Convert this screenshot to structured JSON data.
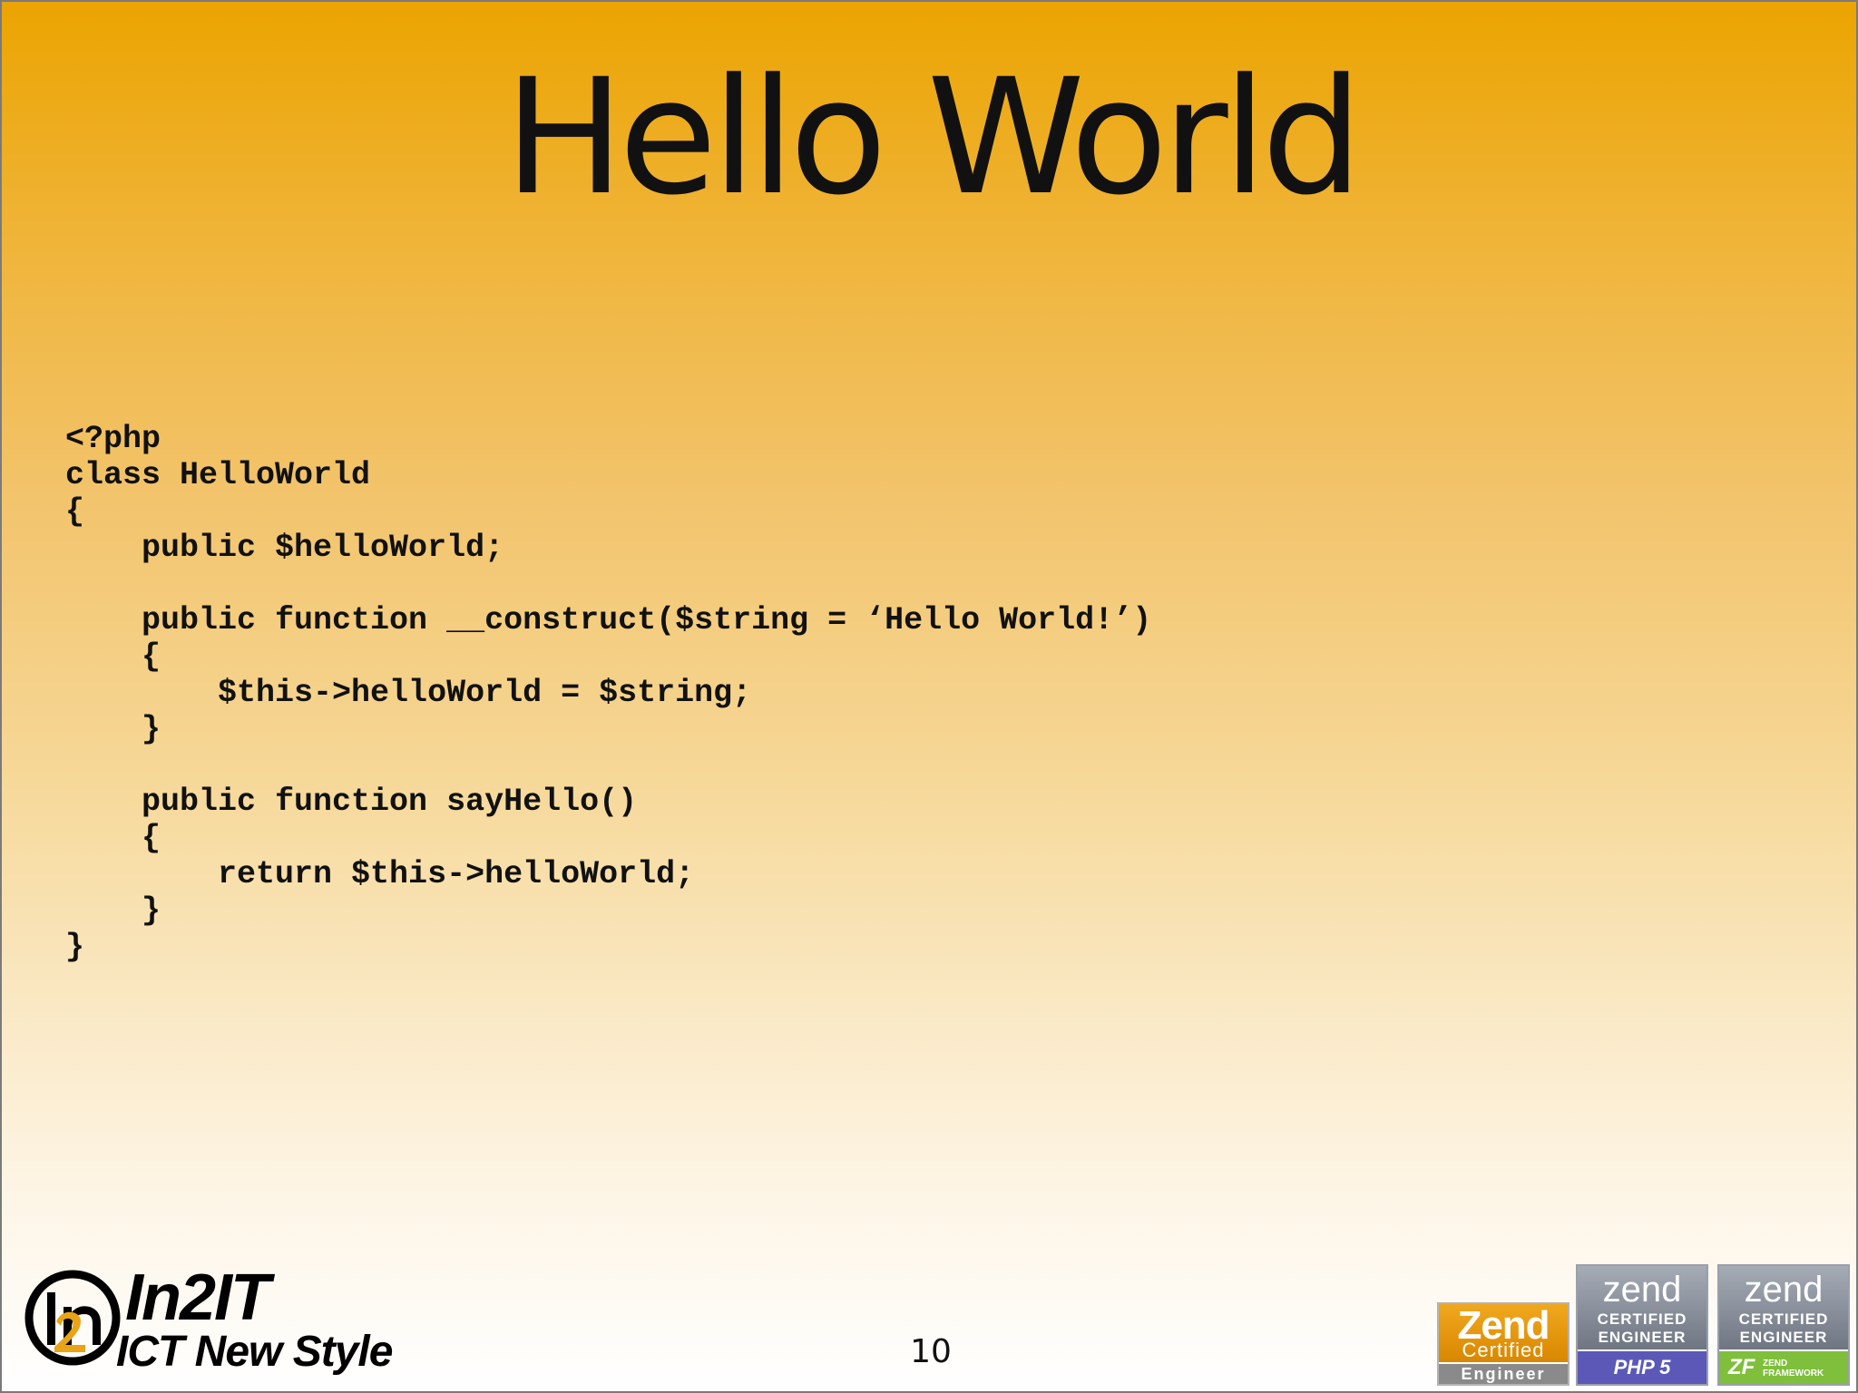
{
  "slide": {
    "title": "Hello World",
    "page_number": "10",
    "code_lines": [
      "<?php",
      "class HelloWorld",
      "{",
      "    public $helloWorld;",
      "",
      "    public function __construct($string = ‘Hello World!’)",
      "    {",
      "        $this->helloWorld = $string;",
      "    }",
      "",
      "    public function sayHello()",
      "    {",
      "        return $this->helloWorld;",
      "    }",
      "}"
    ]
  },
  "footer": {
    "logo_name": "In2IT",
    "logo_tagline": "ICT New Style",
    "logo_mark_text": "in2",
    "logo_mark_icon": "in2it-circle-logo"
  },
  "badges": [
    {
      "brand": "Zend",
      "line1": "Certified",
      "bottom": "Engineer",
      "color": "#e39a0c"
    },
    {
      "brand": "zend",
      "line1": "CERTIFIED",
      "line2": "ENGINEER",
      "bottom": "PHP 5",
      "color": "#5b58b8"
    },
    {
      "brand": "zend",
      "line1": "CERTIFIED",
      "line2": "ENGINEER",
      "bottom_mark": "ZF",
      "bottom_line1": "ZEND",
      "bottom_line2": "FRAMEWORK",
      "color": "#7fbf3b"
    }
  ],
  "colors": {
    "background_top": "#eba400",
    "background_bottom": "#ffffff",
    "text": "#111111"
  }
}
